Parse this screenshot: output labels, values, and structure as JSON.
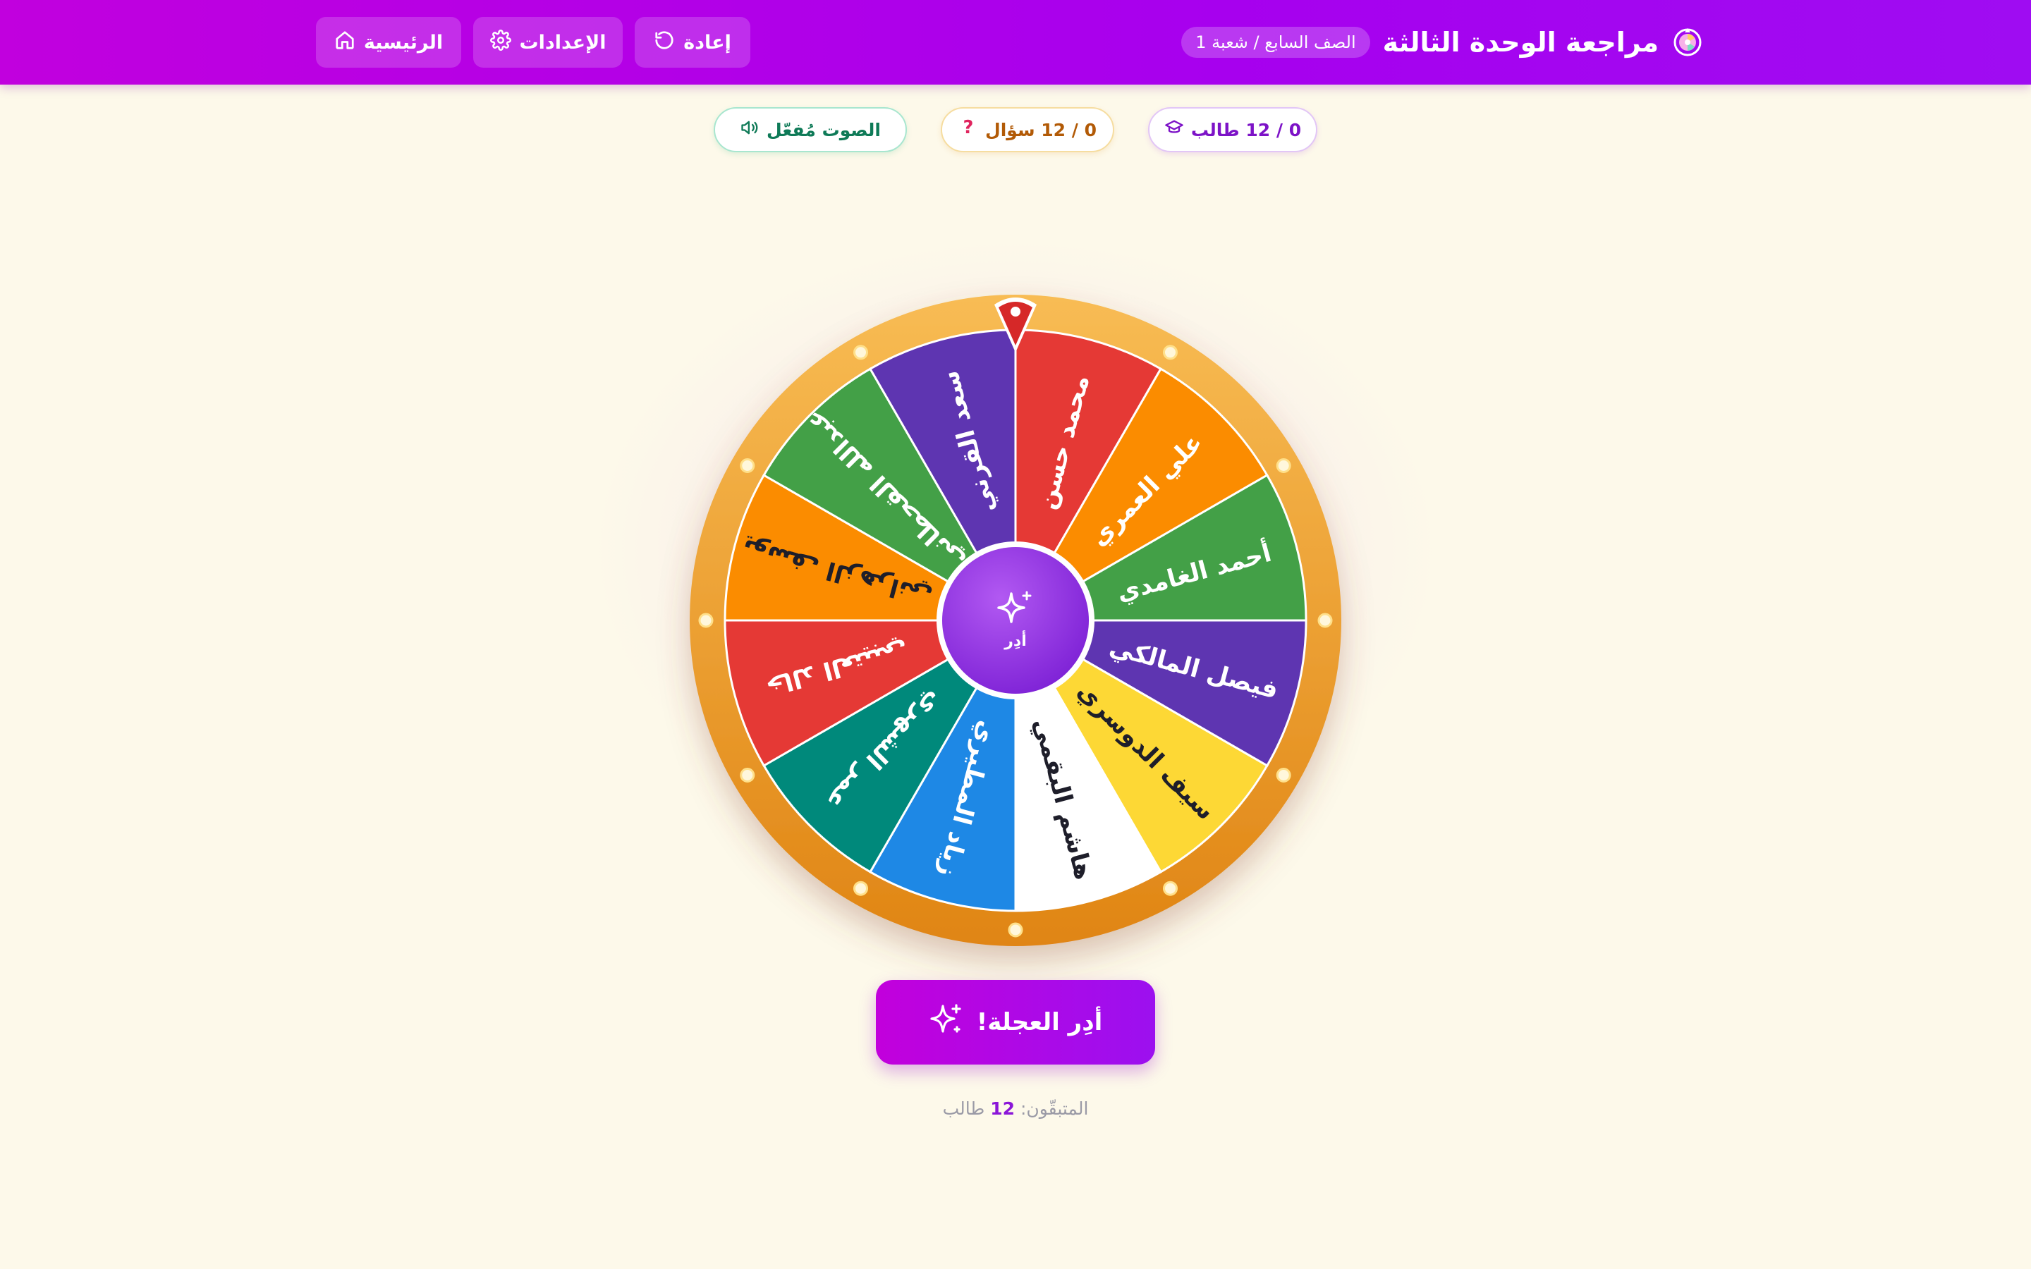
{
  "header": {
    "title": "مراجعة الوحدة الثالثة",
    "class_label": "الصف السابع / شعبة 1",
    "logo_icon": "wheel-logo-icon",
    "buttons": {
      "reset": "إعادة",
      "settings": "الإعدادات",
      "home": "الرئيسية"
    }
  },
  "stats": {
    "students": "0 / 12 طالب",
    "questions": "0 / 12 سؤال",
    "sound": "الصوت مُفعّل"
  },
  "wheel": {
    "center_label": "أدِر",
    "segments": [
      {
        "name": "محمد حسن",
        "color": "#e53935",
        "text_color": "#ffffff"
      },
      {
        "name": "علي العمري",
        "color": "#fb8c00",
        "text_color": "#ffffff"
      },
      {
        "name": "أحمد الغامدي",
        "color": "#43a047",
        "text_color": "#ffffff"
      },
      {
        "name": "فيصل المالكي",
        "color": "#5e35b1",
        "text_color": "#ffffff"
      },
      {
        "name": "سيف الدوسري",
        "color": "#fdd835",
        "text_color": "#1e1e2a"
      },
      {
        "name": "هاشم البقمي",
        "color": "#ffffff",
        "text_color": "#1e1e2a"
      },
      {
        "name": "زياد المطيري",
        "color": "#1e88e5",
        "text_color": "#ffffff"
      },
      {
        "name": "عمر الشهري",
        "color": "#00897b",
        "text_color": "#ffffff"
      },
      {
        "name": "خالد العتيبي",
        "color": "#e53935",
        "text_color": "#ffffff"
      },
      {
        "name": "يوسف الزهراني",
        "color": "#fb8c00",
        "text_color": "#1e1e2a"
      },
      {
        "name": "عبدالله القحطاني",
        "color": "#43a047",
        "text_color": "#ffffff"
      },
      {
        "name": "سعد القرني",
        "color": "#5e35b1",
        "text_color": "#ffffff"
      }
    ]
  },
  "spin_button": "أدِر العجلة!",
  "remaining": {
    "label": "المتبقّون:",
    "count": "12",
    "unit": "طالب"
  },
  "colors": {
    "accent": "#a700ee",
    "rim": "#f4a52b",
    "pointer": "#d62828"
  }
}
